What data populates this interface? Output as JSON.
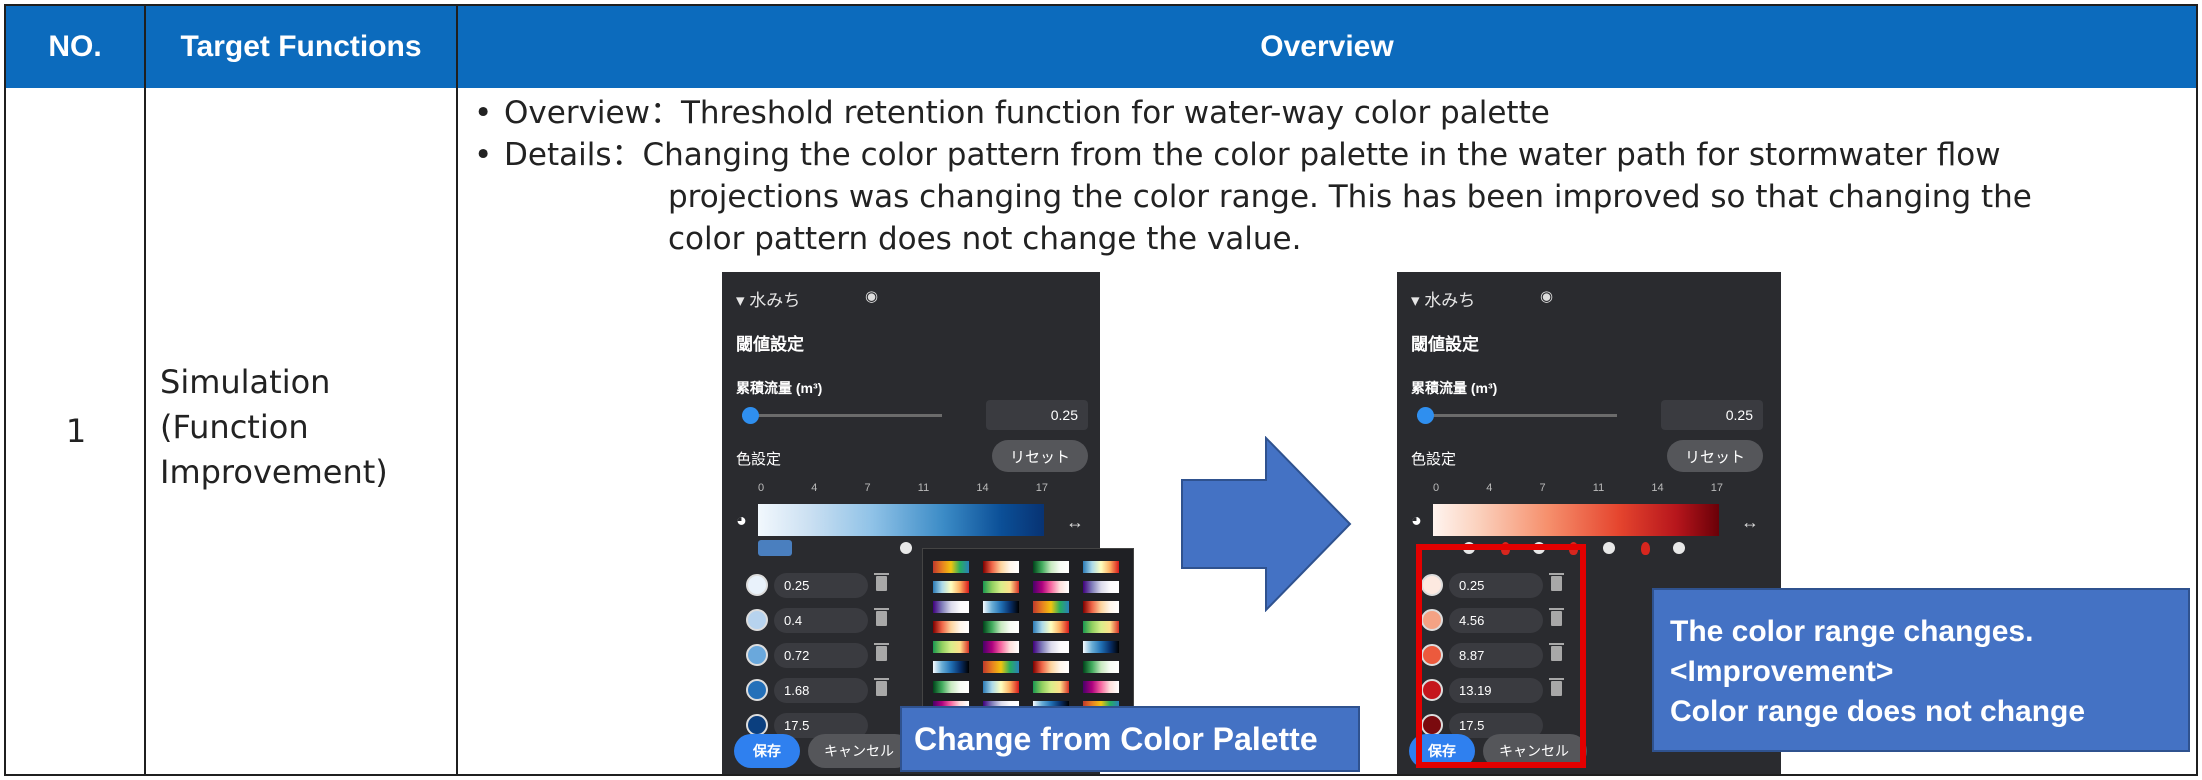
{
  "header": {
    "no": "NO.",
    "target": "Target Functions",
    "overview": "Overview"
  },
  "row": {
    "no": "1",
    "target_lines": [
      "Simulation",
      "(Function",
      "Improvement)"
    ]
  },
  "overview": {
    "line1": "Overview：Threshold retention function for water-way color palette",
    "line2": "Details：Changing the color pattern from the color palette in the water path for stormwater flow",
    "line3": "projections was changing the color range. This has been improved so that changing the",
    "line4": "color pattern does not change the value."
  },
  "panel_left": {
    "layer": "▾ 水みち",
    "eye": "◉",
    "threshold": "閾値設定",
    "unit": "累積流量 (m³)",
    "value": "0.25",
    "color_setting": "色設定",
    "reset": "リセット",
    "ticks": [
      "0",
      "4",
      "7",
      "11",
      "14",
      "17"
    ],
    "stops": [
      "0.25",
      "0.4",
      "0.72",
      "1.68",
      "17.5"
    ],
    "stop_colors": [
      "#e9f2fb",
      "#b7d3ee",
      "#6aa8dc",
      "#2470b9",
      "#0b3f7f"
    ],
    "save": "保存",
    "cancel": "キャンセル"
  },
  "panel_right": {
    "layer": "▾ 水みち",
    "eye": "◉",
    "threshold": "閾値設定",
    "unit": "累積流量 (m³)",
    "value": "0.25",
    "color_setting": "色設定",
    "reset": "リセット",
    "ticks": [
      "0",
      "4",
      "7",
      "11",
      "14",
      "17"
    ],
    "stops": [
      "0.25",
      "4.56",
      "8.87",
      "13.19",
      "17.5"
    ],
    "stop_colors": [
      "#fde9e0",
      "#f4a284",
      "#ec5a3d",
      "#c5161d",
      "#7a0a0e"
    ],
    "save": "保存",
    "cancel": "キャンセル"
  },
  "palette_colors": [
    [
      "#c0392b",
      "#e67e22",
      "#f1c40f",
      "#27ae60",
      "#2980b9"
    ],
    [
      "#2c7bb6",
      "#abd9e9",
      "#ffffbf",
      "#fdae61",
      "#d7191c"
    ],
    [
      "#3f007d",
      "#807dba",
      "#dadaeb",
      "#fcfbfd",
      "#ffffff"
    ],
    [
      "#7f0000",
      "#ef6548",
      "#fdd49e",
      "#fff7ec",
      "#ffffff"
    ],
    [
      "#1a9850",
      "#91cf60",
      "#d9ef8b",
      "#fee08b",
      "#d73027"
    ],
    [
      "#f7fbff",
      "#6baed6",
      "#2171b5",
      "#08306b",
      "#000000"
    ],
    [
      "#00441b",
      "#41ab5d",
      "#c7e9c0",
      "#f7fcf5",
      "#ffffff"
    ],
    [
      "#49006a",
      "#ae017e",
      "#f768a1",
      "#fde0dd",
      "#ffffff"
    ]
  ],
  "callouts": {
    "left": "Change from Color Palette",
    "right_l1": "The color range changes.",
    "right_l2": "<Improvement>",
    "right_l3": "Color range does not change"
  },
  "colors": {
    "header": "#0c6bbd",
    "callout": "#4472c4",
    "arrow": "#4472c4",
    "highlight": "#e30000"
  }
}
